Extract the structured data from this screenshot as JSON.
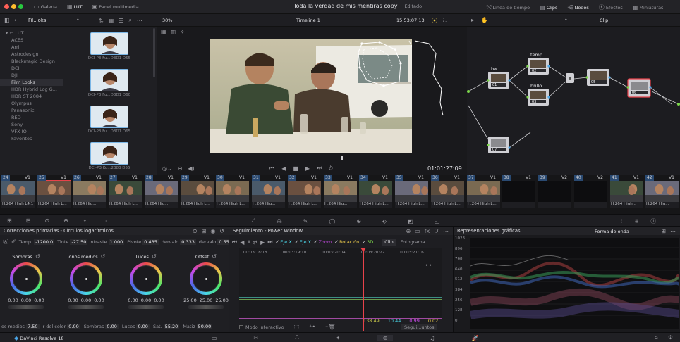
{
  "window": {
    "title": "Toda la verdad de mis mentiras copy",
    "status": "Editado"
  },
  "topbar": {
    "left_items": [
      "Galería",
      "LUT",
      "Panel multimedia"
    ],
    "right_items": [
      "Línea de tiempo",
      "Clips",
      "Nodos",
      "Efectos",
      "Miniaturas"
    ]
  },
  "subbar": {
    "panel_title": "Fil...oks",
    "zoom": "30%",
    "timeline_name": "Timeline 1",
    "timecode": "15:53:07:13",
    "clip_label": "Clip"
  },
  "mediapool": {
    "root": "LUT",
    "folders": [
      "ACES",
      "Arri",
      "Astrodesign",
      "Blackmagic Design",
      "DCI",
      "DJI",
      "Film Looks",
      "HDR Hybrid Log G...",
      "HDR ST 2084",
      "Olympus",
      "Panasonic",
      "RED",
      "Sony",
      "VFX IO",
      "Favoritos"
    ],
    "selected_index": 6,
    "thumbs": [
      {
        "caption": "DCI-P3 Fu...D3D1 D55"
      },
      {
        "caption": "DCI-P3 Fu...D3D1 D60"
      },
      {
        "caption": "DCI-P3 Fu...D3D1 D65"
      },
      {
        "caption": "DCI-P3 Ko...2383 D55"
      }
    ]
  },
  "viewer": {
    "timecode": "01:01:27:09"
  },
  "nodes": {
    "labels": [
      "bw",
      "temp",
      "brillo",
      "01",
      "02",
      "03",
      "05",
      "06",
      "07"
    ]
  },
  "strip": {
    "clips": [
      {
        "num": "24",
        "track": "V1",
        "foot": "H.264 High L4.1"
      },
      {
        "num": "25",
        "track": "V1",
        "foot": "H.264 High L..."
      },
      {
        "num": "26",
        "track": "V1",
        "foot": "H.264 Hig..."
      },
      {
        "num": "27",
        "track": "V1",
        "foot": "H.264 High L..."
      },
      {
        "num": "28",
        "track": "V1",
        "foot": "H.264 Hig..."
      },
      {
        "num": "29",
        "track": "V1",
        "foot": "H.264 High L..."
      },
      {
        "num": "30",
        "track": "V1",
        "foot": "H.264 High L..."
      },
      {
        "num": "31",
        "track": "V1",
        "foot": "H.264 Hig..."
      },
      {
        "num": "32",
        "track": "V1",
        "foot": "H.264 High L..."
      },
      {
        "num": "33",
        "track": "V1",
        "foot": "H.264 Hig..."
      },
      {
        "num": "34",
        "track": "V1",
        "foot": "H.264 High L..."
      },
      {
        "num": "35",
        "track": "V1",
        "foot": "H.264 High L..."
      },
      {
        "num": "36",
        "track": "V1",
        "foot": "H.264 High L..."
      },
      {
        "num": "37",
        "track": "V1",
        "foot": "H.264 High L..."
      },
      {
        "num": "38",
        "track": "V1",
        "foot": ""
      },
      {
        "num": "39",
        "track": "V2",
        "foot": ""
      },
      {
        "num": "40",
        "track": "V2",
        "foot": ""
      },
      {
        "num": "41",
        "track": "V1",
        "foot": "H.264 High..."
      },
      {
        "num": "42",
        "track": "V1",
        "foot": "H.264 Hig..."
      }
    ]
  },
  "primaries": {
    "title": "Correcciones primarias - Círculos logarítmicos",
    "params": [
      {
        "label": "Temp.",
        "value": "-1200.0"
      },
      {
        "label": "Tinte",
        "value": "-27.50"
      },
      {
        "label": "ntraste",
        "value": "1.000"
      },
      {
        "label": "Pivote",
        "value": "0.435"
      },
      {
        "label": "dervalo",
        "value": "0.333"
      },
      {
        "label": "dervalo",
        "value": "0.553"
      }
    ],
    "wheels": [
      {
        "name": "Sombras",
        "values": [
          "0.00",
          "0.00",
          "0.00"
        ]
      },
      {
        "name": "Tonos medios",
        "values": [
          "0.00",
          "0.00",
          "0.00"
        ]
      },
      {
        "name": "Luces",
        "values": [
          "0.00",
          "0.00",
          "0.00"
        ]
      },
      {
        "name": "Offset",
        "values": [
          "25.00",
          "25.00",
          "25.00"
        ]
      }
    ],
    "bottom": [
      {
        "label": "os medios",
        "value": "7.50"
      },
      {
        "label": "r del color",
        "value": "0.00"
      },
      {
        "label": "Sombras",
        "value": "0.00"
      },
      {
        "label": "Luces",
        "value": "0.00"
      },
      {
        "label": "Sat.",
        "value": "55.20"
      },
      {
        "label": "Matiz",
        "value": "50.00"
      }
    ]
  },
  "tracking": {
    "title": "Seguimiento - Power Window",
    "checks": [
      "Eje X",
      "Eje Y",
      "Zoom",
      "Rotación",
      "3D"
    ],
    "clip_btn": "Clip",
    "frame_btn": "Fotograma",
    "ruler": [
      "00:03:18:18",
      "00:03:19:10",
      "00:03:20:04",
      "00:03:20:22",
      "00:03:21:16"
    ],
    "readouts": [
      "138.49",
      "10.44",
      "0.99",
      "0.02"
    ],
    "interactive": "Modo interactivo",
    "follow": "Segui...untos"
  },
  "scopes": {
    "title": "Representaciones gráficas",
    "mode": "Forma de onda",
    "ticks": [
      "1023",
      "896",
      "768",
      "640",
      "512",
      "384",
      "256",
      "128",
      "0"
    ]
  },
  "footer": {
    "app": "DaVinci Resolve 18"
  },
  "colors": {
    "accent": "#e8424a",
    "node_green": "#7bd64a",
    "node_blue": "#4aa6e8"
  }
}
